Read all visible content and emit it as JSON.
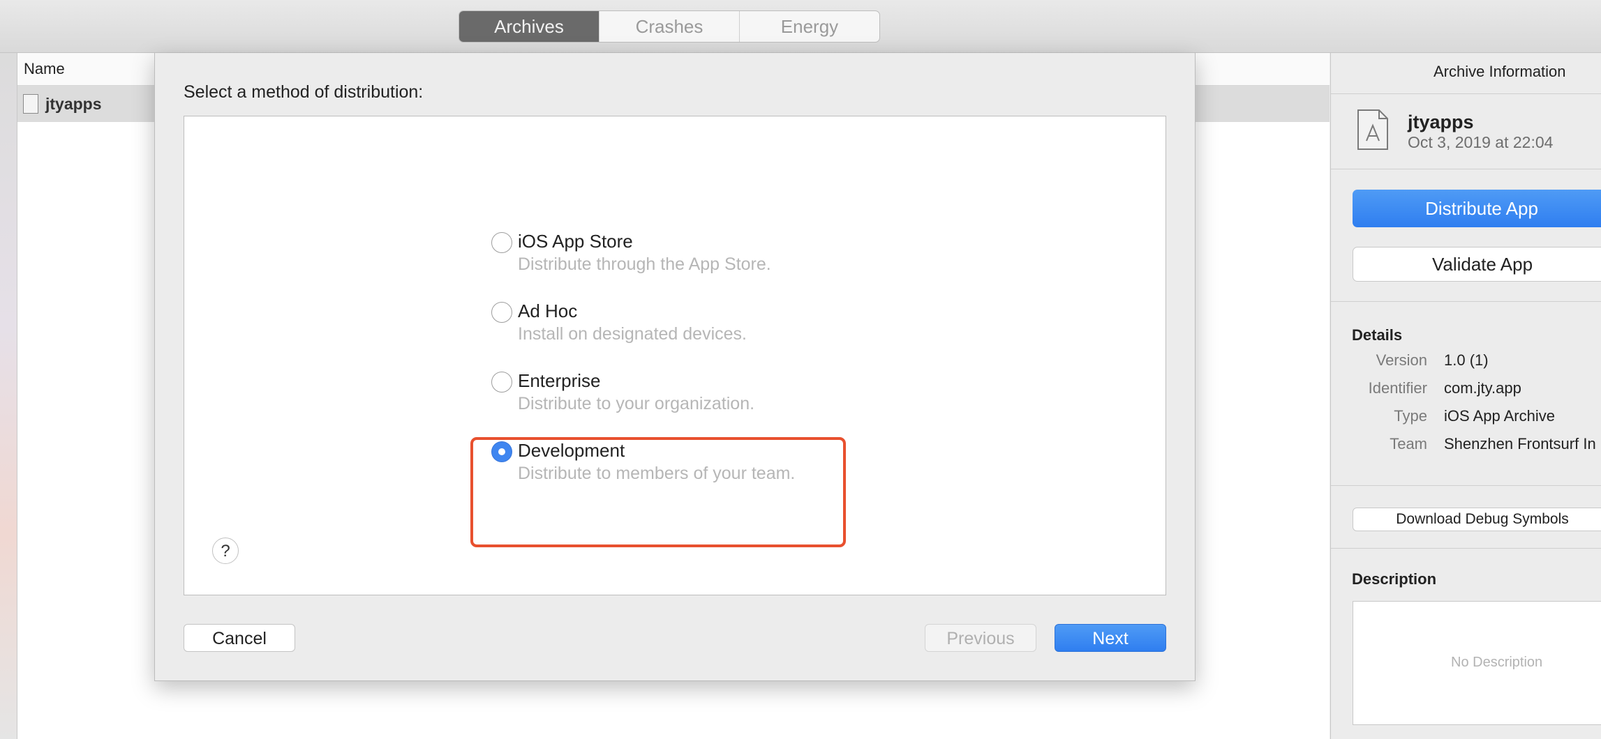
{
  "toolbar": {
    "tabs": [
      {
        "label": "Archives",
        "active": true
      },
      {
        "label": "Crashes",
        "active": false
      },
      {
        "label": "Energy",
        "active": false
      }
    ]
  },
  "list": {
    "column_name": "Name",
    "rows": [
      {
        "name": "jtyapps",
        "icon": "archive-document-icon"
      }
    ]
  },
  "sheet": {
    "title": "Select a method of distribution:",
    "options": [
      {
        "label": "iOS App Store",
        "description": "Distribute through the App Store.",
        "selected": false
      },
      {
        "label": "Ad Hoc",
        "description": "Install on designated devices.",
        "selected": false
      },
      {
        "label": "Enterprise",
        "description": "Distribute to your organization.",
        "selected": false
      },
      {
        "label": "Development",
        "description": "Distribute to members of your team.",
        "selected": true
      }
    ],
    "help_label": "?",
    "cancel_label": "Cancel",
    "previous_label": "Previous",
    "next_label": "Next",
    "highlight_color": "#e8502e"
  },
  "inspector": {
    "title": "Archive Information",
    "archive_name": "jtyapps",
    "archive_date": "Oct 3, 2019 at 22:04",
    "distribute_label": "Distribute App",
    "validate_label": "Validate App",
    "details_title": "Details",
    "details": [
      {
        "key": "Version",
        "value": "1.0 (1)"
      },
      {
        "key": "Identifier",
        "value": "com.jty.app"
      },
      {
        "key": "Type",
        "value": "iOS App Archive"
      },
      {
        "key": "Team",
        "value": "Shenzhen Frontsurf In"
      }
    ],
    "debug_symbols_label": "Download Debug Symbols",
    "description_title": "Description",
    "description_placeholder": "No Description"
  },
  "colors": {
    "accent": "#2f7ef0",
    "segment_active": "#6a6a6a"
  }
}
